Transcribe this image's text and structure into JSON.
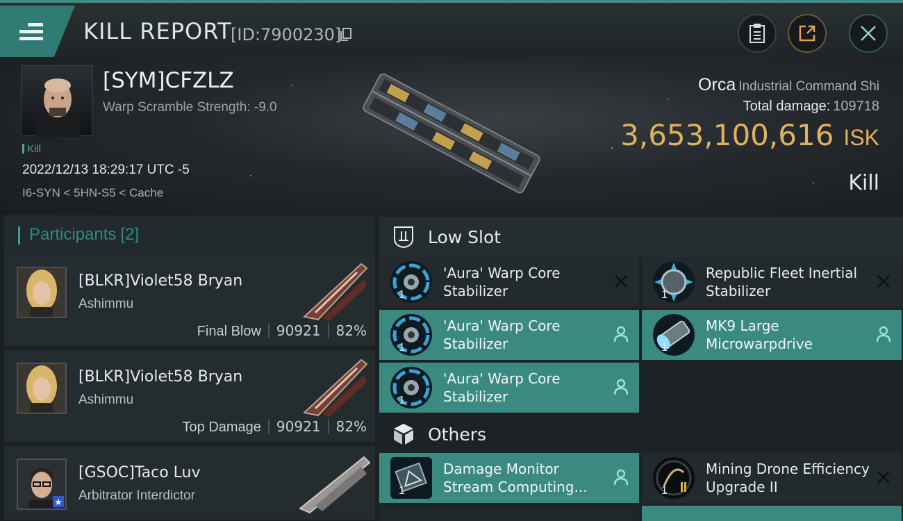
{
  "header": {
    "title": "KILL REPORT",
    "report_id": "[ID:7900230]"
  },
  "victim": {
    "name": "[SYM]CFZLZ",
    "warp_scramble": "Warp Scramble Strength: -9.0",
    "tag": "Kill",
    "datetime": "2022/12/13 18:29:17 UTC -5",
    "location": "I6-SYN < 5HN-S5 < Cache",
    "ship": "Orca",
    "ship_class": "Industrial Command Shi",
    "total_damage_label": "Total damage:",
    "total_damage": "109718",
    "isk_value": "3,653,100,616",
    "isk_unit": "ISK",
    "result": "Kill"
  },
  "participants": {
    "label": "Participants",
    "count": "[2]",
    "rows": [
      {
        "name": "[BLKR]Violet58 Bryan",
        "ship": "Ashimmu",
        "role": "Final Blow",
        "damage": "90921",
        "percent": "82%"
      },
      {
        "name": "[BLKR]Violet58 Bryan",
        "ship": "Ashimmu",
        "role": "Top Damage",
        "damage": "90921",
        "percent": "82%"
      },
      {
        "name": "[GSOC]Taco Luv",
        "ship": "Arbitrator Interdictor"
      }
    ]
  },
  "fitting": {
    "low_slot_label": "Low Slot",
    "others_label": "Others",
    "low_slot": [
      {
        "name": "'Aura' Warp Core Stabilizer",
        "qty": "1",
        "state": "destroyed"
      },
      {
        "name": "Republic Fleet Inertial Stabilizer",
        "qty": "1",
        "state": "destroyed"
      },
      {
        "name": "'Aura' Warp Core Stabilizer",
        "qty": "1",
        "state": "dropped"
      },
      {
        "name": "MK9 Large Microwarpdrive",
        "qty": "1",
        "state": "dropped"
      },
      {
        "name": "'Aura' Warp Core Stabilizer",
        "qty": "1",
        "state": "dropped"
      }
    ],
    "others": [
      {
        "name": "Damage Monitor Stream Computing...",
        "qty": "1",
        "state": "dropped"
      },
      {
        "name": "Mining Drone Efficiency Upgrade II",
        "qty": "1",
        "state": "destroyed"
      }
    ]
  },
  "colors": {
    "accent": "#3b8a82",
    "isk": "#e0b25c",
    "panel": "#222a2d"
  }
}
